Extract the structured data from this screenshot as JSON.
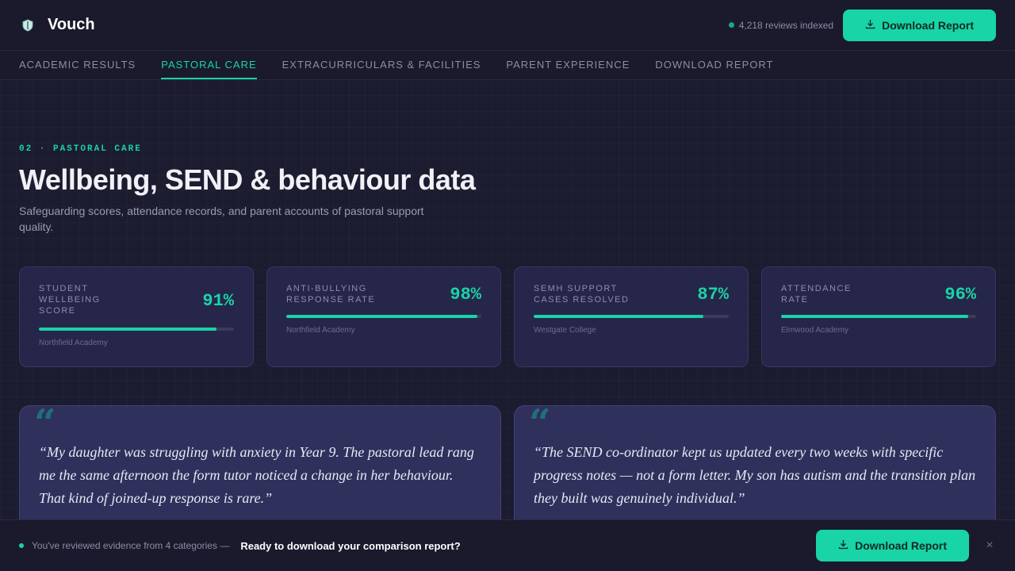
{
  "header": {
    "brand": "Vouch",
    "indexed_text": "4,218 reviews indexed",
    "download_label": "Download Report"
  },
  "nav": {
    "items": [
      {
        "label": "ACADEMIC RESULTS",
        "active": false
      },
      {
        "label": "PASTORAL CARE",
        "active": true
      },
      {
        "label": "EXTRACURRICULARS & FACILITIES",
        "active": false
      },
      {
        "label": "PARENT EXPERIENCE",
        "active": false
      },
      {
        "label": "DOWNLOAD REPORT",
        "active": false
      }
    ]
  },
  "section": {
    "eyebrow": "02 · PASTORAL CARE",
    "title": "Wellbeing, SEND & behaviour data",
    "subtitle": "Safeguarding scores, attendance records, and parent accounts of pastoral support quality."
  },
  "stats": [
    {
      "label": "STUDENT WELLBEING SCORE",
      "value": "91%",
      "fill": 0.91,
      "school": "Northfield Academy"
    },
    {
      "label": "ANTI-BULLYING RESPONSE RATE",
      "value": "98%",
      "fill": 0.98,
      "school": "Northfield Academy"
    },
    {
      "label": "SEMH SUPPORT CASES RESOLVED",
      "value": "87%",
      "fill": 0.87,
      "school": "Westgate College"
    },
    {
      "label": "ATTENDANCE RATE",
      "value": "96%",
      "fill": 0.96,
      "school": "Elmwood Academy"
    }
  ],
  "quotes": [
    {
      "mark": "“",
      "text": "“My daughter was struggling with anxiety in Year 9. The pastoral lead rang me the same afternoon the form tutor noticed a change in her behaviour. That kind of joined-up response is rare.”"
    },
    {
      "mark": "“",
      "text": "“The SEND co-ordinator kept us updated every two weeks with specific progress notes — not a form letter. My son has autism and the transition plan they built was genuinely individual.”"
    }
  ],
  "bottom_bar": {
    "muted_text": "You've reviewed evidence from 4 categories —",
    "strong_text": "Ready to download your comparison report?",
    "download_label": "Download Report",
    "close_glyph": "×"
  },
  "colors": {
    "accent": "#19d4a6",
    "background": "#1c1c30",
    "card": "#26264a",
    "quote_card": "#30305c"
  }
}
